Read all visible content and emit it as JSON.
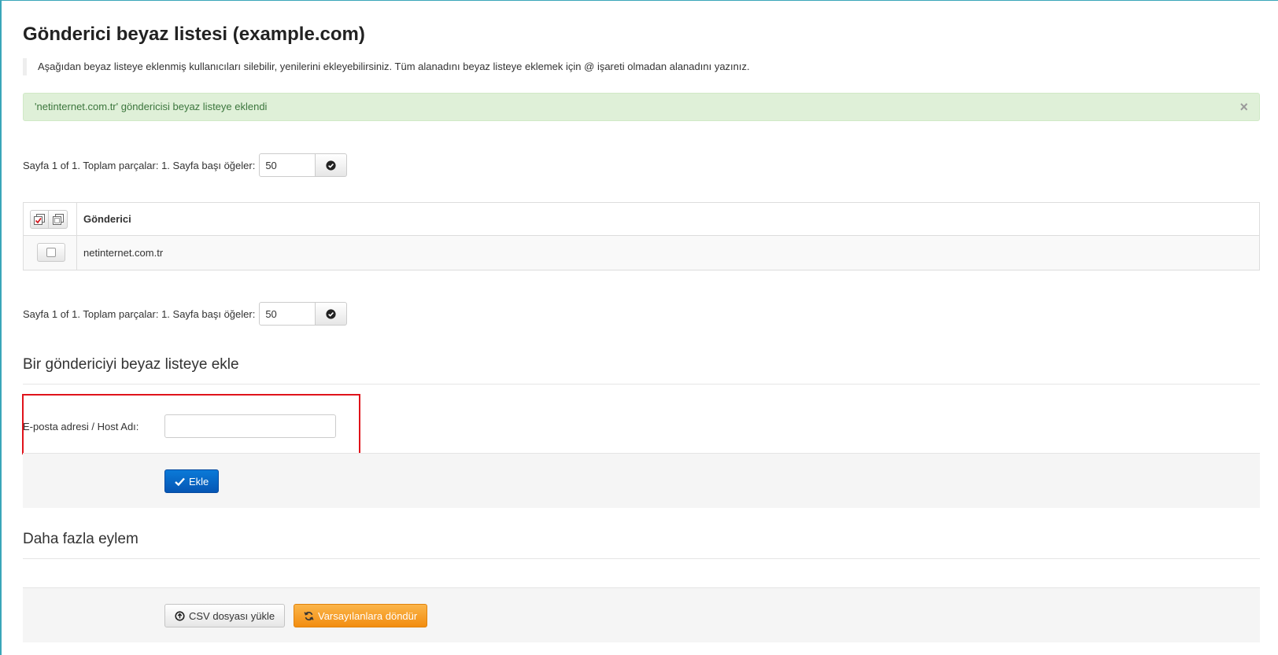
{
  "page": {
    "title": "Gönderici beyaz listesi (example.com)",
    "intro": "Aşağıdan beyaz listeye eklenmiş kullanıcıları silebilir, yenilerini ekleyebilirsiniz. Tüm alanadını beyaz listeye eklemek için @ işareti olmadan alanadını yazınız."
  },
  "alert": {
    "message": "'netinternet.com.tr' göndericisi beyaz listeye eklendi",
    "close_glyph": "×"
  },
  "pager": {
    "text": "Sayfa 1 of 1. Toplam parçalar: 1. Sayfa başı öğeler:",
    "per_page": "50",
    "go_icon": "check-circle-icon"
  },
  "table": {
    "column_header": "Gönderici",
    "rows": [
      {
        "sender": "netinternet.com.tr",
        "checked": false
      }
    ]
  },
  "add_section": {
    "title": "Bir göndericiyi beyaz listeye ekle",
    "field_label": "E-posta adresi / Host Adı:",
    "field_value": "",
    "add_button": "Ekle"
  },
  "more_section": {
    "title": "Daha fazla eylem",
    "csv_button": "CSV dosyası yükle",
    "reset_button": "Varsayılanlara döndür"
  },
  "colors": {
    "success_bg": "#dff0d8",
    "success_text": "#3c763d",
    "primary": "#0a68c8",
    "warning": "#f5a023",
    "highlight": "#e0131b"
  }
}
